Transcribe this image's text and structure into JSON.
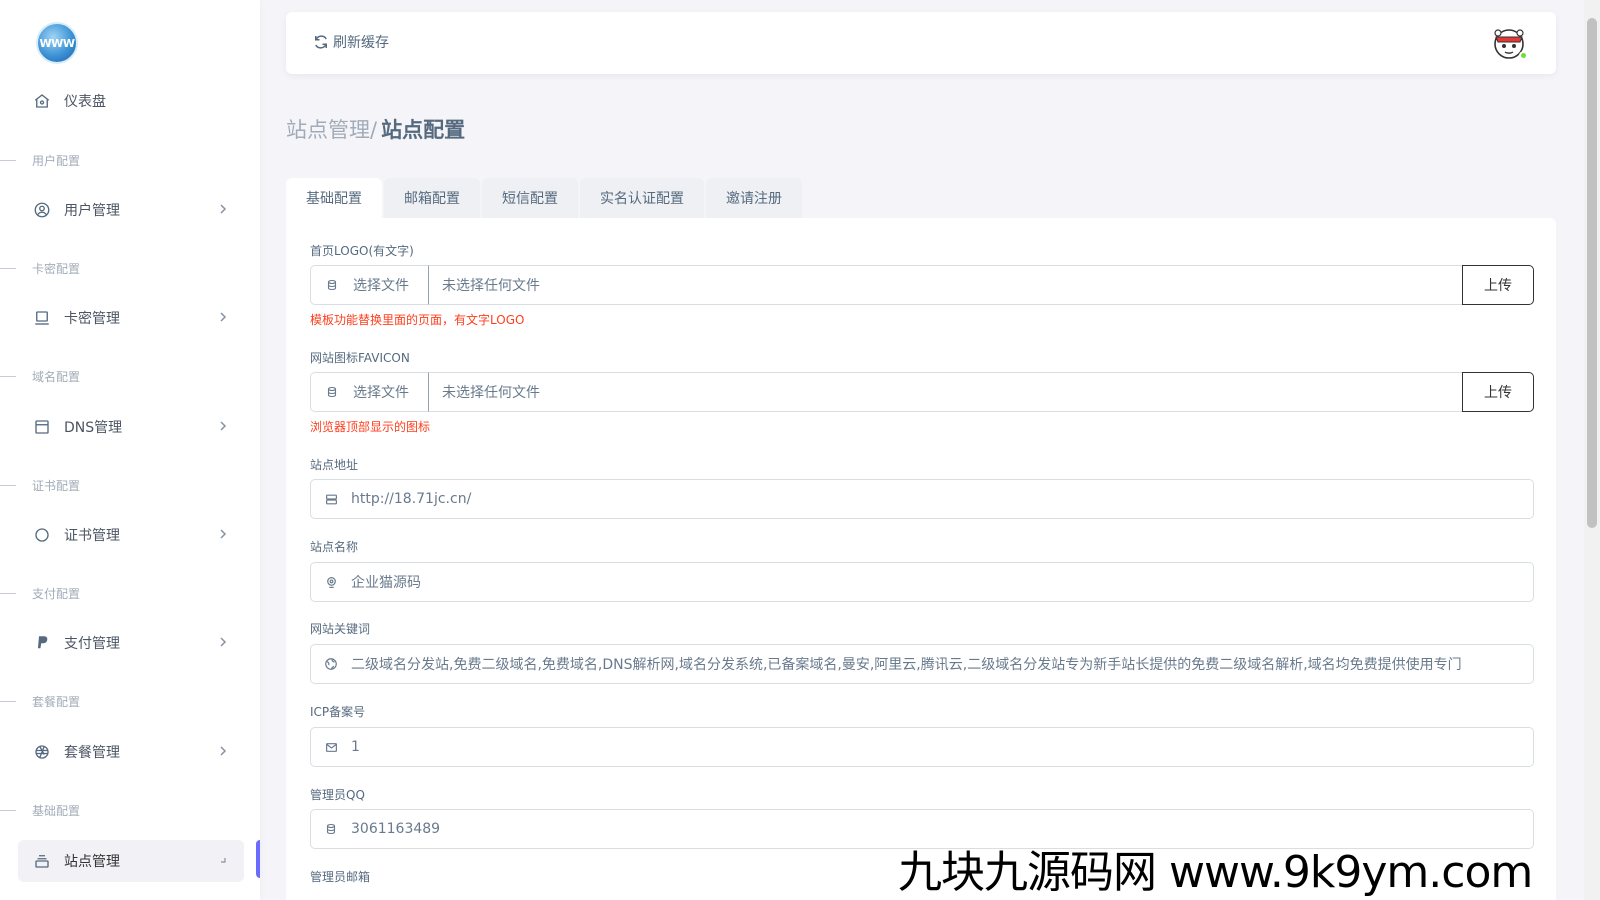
{
  "sidebar": {
    "items": [
      {
        "label": "仪表盘",
        "icon": "home-icon"
      },
      {
        "label": "用户管理",
        "icon": "user-circle-icon",
        "section": "用户配置"
      },
      {
        "label": "卡密管理",
        "icon": "card-icon",
        "section": "卡密配置"
      },
      {
        "label": "DNS管理",
        "icon": "window-icon",
        "section": "域名配置"
      },
      {
        "label": "证书管理",
        "icon": "circle-icon",
        "section": "证书配置"
      },
      {
        "label": "支付管理",
        "icon": "paypal-icon",
        "section": "支付配置"
      },
      {
        "label": "套餐管理",
        "icon": "aperture-icon",
        "section": "套餐配置"
      },
      {
        "label": "站点管理",
        "icon": "stack-icon",
        "section": "基础配置",
        "active": true
      }
    ],
    "sections": [
      "用户配置",
      "卡密配置",
      "域名配置",
      "证书配置",
      "支付配置",
      "套餐配置",
      "基础配置"
    ]
  },
  "topbar": {
    "refresh_label": "刷新缓存"
  },
  "page": {
    "breadcrumb_parent": "站点管理/",
    "breadcrumb_current": "站点配置"
  },
  "tabs": [
    "基础配置",
    "邮箱配置",
    "短信配置",
    "实名认证配置",
    "邀请注册"
  ],
  "form": {
    "logo": {
      "label": "首页LOGO(有文字)",
      "pick_label": "选择文件",
      "file_placeholder": "未选择任何文件",
      "upload_label": "上传",
      "hint": "模板功能替换里面的页面，有文字LOGO"
    },
    "favicon": {
      "label": "网站图标FAVICON",
      "pick_label": "选择文件",
      "file_placeholder": "未选择任何文件",
      "upload_label": "上传",
      "hint": "浏览器顶部显示的图标"
    },
    "site_url": {
      "label": "站点地址",
      "value": "http://18.71jc.cn/"
    },
    "site_name": {
      "label": "站点名称",
      "value": "企业猫源码"
    },
    "keywords": {
      "label": "网站关键词",
      "value": "二级域名分发站,免费二级域名,免费域名,DNS解析网,域名分发系统,已备案域名,曼安,阿里云,腾讯云,二级域名分发站专为新手站长提供的免费二级域名解析,域名均免费提供使用专门"
    },
    "icp": {
      "label": "ICP备案号",
      "value": "1"
    },
    "admin_qq": {
      "label": "管理员QQ",
      "value": "3061163489"
    },
    "admin_email": {
      "label": "管理员邮箱"
    }
  },
  "watermark": "九块九源码网 www.9k9ym.com",
  "colors": {
    "accent": "#696cff",
    "hint_red": "#ff3e1d",
    "online": "#71dd37"
  }
}
